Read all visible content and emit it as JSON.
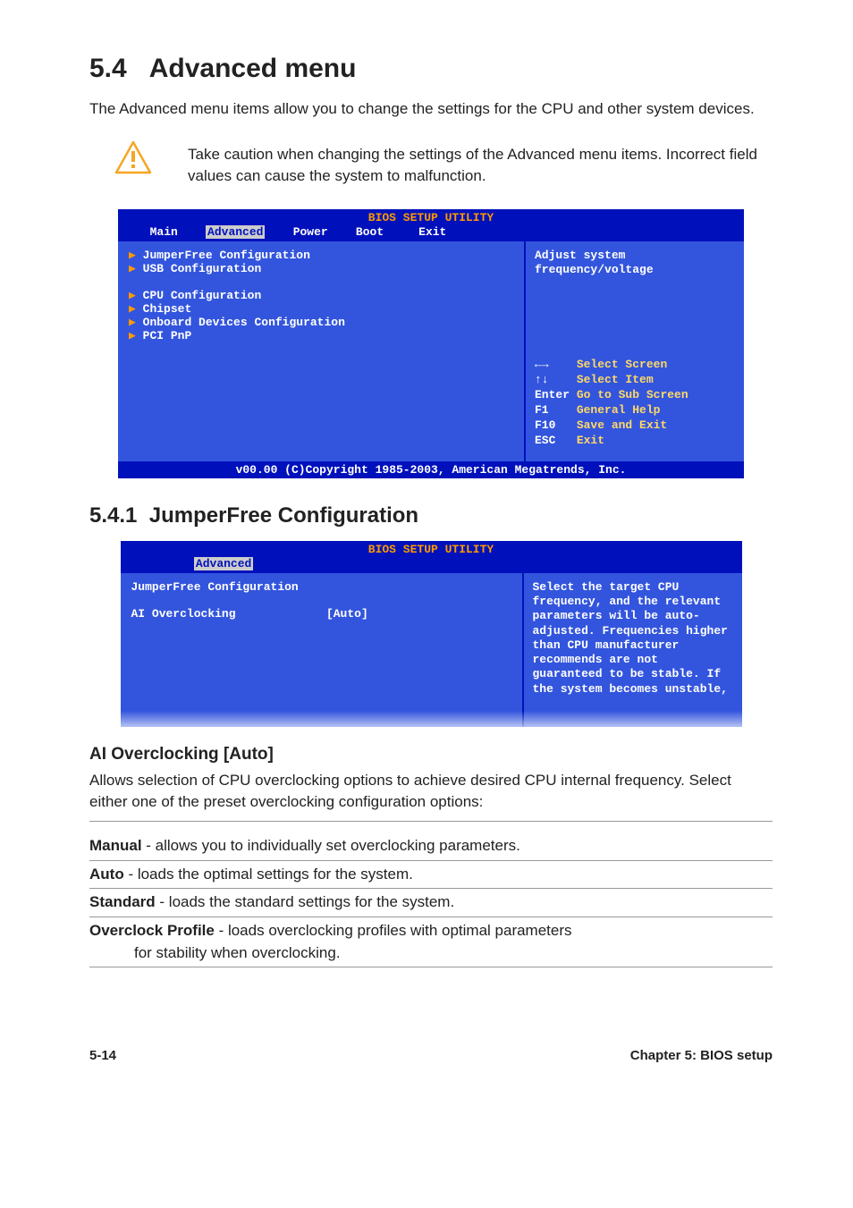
{
  "section": {
    "number": "5.4",
    "title": "Advanced menu",
    "intro": "The Advanced menu items allow you to change the settings for the CPU and other system devices.",
    "callout": "Take caution when changing the settings of the Advanced menu items. Incorrect field values can cause the system to malfunction."
  },
  "bios1": {
    "title": "BIOS SETUP UTILITY",
    "tabs": {
      "main": "Main",
      "advanced": "Advanced",
      "power": "Power",
      "boot": "Boot",
      "exit": "Exit"
    },
    "menu": [
      "JumperFree Configuration",
      "USB Configuration",
      "",
      "CPU Configuration",
      "Chipset",
      "Onboard Devices Configuration",
      "PCI PnP"
    ],
    "help": "Adjust system\nfrequency/voltage",
    "legend": {
      "l1k": "←→",
      "l1v": "Select Screen",
      "l2k": "↑↓",
      "l2v": "Select Item",
      "l3k": "Enter",
      "l3v": "Go to Sub Screen",
      "l4k": "F1",
      "l4v": "General Help",
      "l5k": "F10",
      "l5v": "Save and Exit",
      "l6k": "ESC",
      "l6v": "Exit"
    },
    "footer": "v00.00 (C)Copyright 1985-2003, American Megatrends, Inc."
  },
  "subsection": {
    "number": "5.4.1",
    "title": "JumperFree Configuration"
  },
  "bios2": {
    "title": "BIOS SETUP UTILITY",
    "tab": "Advanced",
    "header": "JumperFree Configuration",
    "row_label": "AI Overclocking",
    "row_value": "[Auto]",
    "help": "Select the target CPU frequency, and the relevant parameters will be auto-adjusted. Frequencies higher than CPU manufacturer recommends are not guaranteed to be stable. If the system becomes unstable,"
  },
  "setting": {
    "heading": "AI Overclocking [Auto]",
    "desc": "Allows selection of CPU overclocking options to achieve desired CPU internal frequency. Select either one of the preset overclocking configuration options:",
    "options": [
      {
        "term": "Manual",
        "text": " - allows you to individually set overclocking parameters."
      },
      {
        "term": "Auto",
        "text": " - loads the optimal settings for the system."
      },
      {
        "term": "Standard",
        "text": " - loads the standard settings for the system."
      },
      {
        "term": "Overclock Profile",
        "text": " - loads overclocking profiles with optimal parameters for stability when overclocking.",
        "indent": true
      }
    ]
  },
  "footer": {
    "left": "5-14",
    "right": "Chapter 5: BIOS setup"
  }
}
